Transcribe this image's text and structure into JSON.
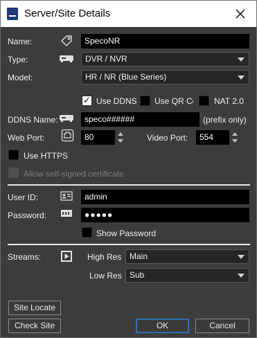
{
  "window": {
    "title": "Server/Site Details"
  },
  "form": {
    "name_label": "Name:",
    "name_value": "SpecoNR",
    "type_label": "Type:",
    "type_value": "DVR / NVR",
    "model_label": "Model:",
    "model_value": "HR / NR (Blue Series)",
    "use_ddns_label": "Use DDNS",
    "use_ddns_checked": true,
    "use_qr_label": "Use QR Co",
    "use_qr_checked": false,
    "nat_label": "NAT 2.0",
    "nat_checked": false,
    "ddns_name_label": "DDNS Name:",
    "ddns_name_value": "speco######",
    "ddns_hint": "(prefix only)",
    "web_port_label": "Web Port:",
    "web_port_value": "80",
    "video_port_label": "Video Port:",
    "video_port_value": "554",
    "use_https_label": "Use HTTPS",
    "use_https_checked": false,
    "self_signed_label": "Allow self-signed certificate",
    "self_signed_checked": false,
    "user_id_label": "User ID:",
    "user_id_value": "admin",
    "password_label": "Password:",
    "password_value": "●●●●●",
    "show_password_label": "Show Password",
    "show_password_checked": false,
    "streams_label": "Streams:",
    "high_res_label": "High Res",
    "high_res_value": "Main",
    "low_res_label": "Low Res",
    "low_res_value": "Sub"
  },
  "buttons": {
    "site_locate": "Site Locate",
    "check_site": "Check Site",
    "ok": "OK",
    "cancel": "Cancel"
  },
  "icons": {
    "app": "speco-guard-icon",
    "close": "close-icon",
    "name": "tag-icon",
    "type": "dvr-device-icon",
    "ddns": "dvr-device-icon",
    "web_port": "network-port-icon",
    "user_id": "id-card-icon",
    "password": "password-icon",
    "streams": "video-play-icon"
  }
}
